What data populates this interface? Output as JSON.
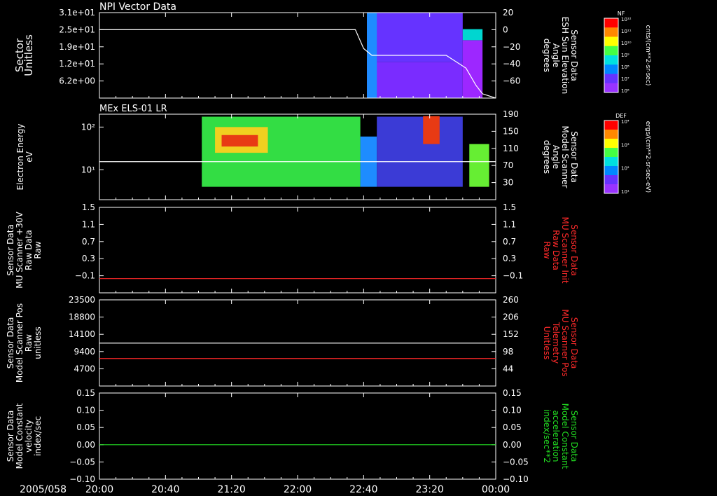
{
  "title": "NPI Vector Data",
  "colors": {
    "white": "#ffffff",
    "red": "#ff2a2a",
    "green": "#22dd22",
    "background": "#000000"
  },
  "x_axis": {
    "date_label": "2005/058",
    "tick_labels": [
      "20:00",
      "20:40",
      "21:20",
      "22:00",
      "22:40",
      "23:20",
      "00:00"
    ]
  },
  "colorbars": [
    {
      "label": "NF",
      "unit": "cnts/(cm**2-sr-sec)",
      "tick_labels": [
        "10¹²",
        "10¹¹",
        "10¹⁰",
        "10⁹",
        "10⁸",
        "10⁷",
        "10⁶"
      ]
    },
    {
      "label": "DEF",
      "unit": "ergs/(cm**2-sr-sec-eV)",
      "tick_labels": [
        "10⁴",
        "10³",
        "10²",
        "10¹"
      ]
    }
  ],
  "chart_data": [
    {
      "type": "heatmap",
      "panel_id": "npi",
      "panel_title": "",
      "ylabel": [
        "Sector",
        "Unitless"
      ],
      "yticks": [
        "3.1e+01",
        "2.5e+01",
        "1.9e+01",
        "1.2e+01",
        "6.2e+00"
      ],
      "ylim": [
        0,
        31
      ],
      "right_label": [
        "Sensor Data",
        "ESH Sun Elevation",
        "Angle",
        "degrees"
      ],
      "right_label_color": "#ffffff",
      "right_ticks": [
        "20",
        "0",
        "−20",
        "−40",
        "−60"
      ],
      "right_lim": [
        -80,
        20
      ],
      "xlim": [
        0,
        240
      ],
      "colorbar": "NF",
      "blocks": [
        {
          "x0": 162,
          "x1": 220,
          "y0": 13,
          "y1": 31,
          "color": "#6633ff"
        },
        {
          "x0": 162,
          "x1": 220,
          "y0": 0,
          "y1": 13,
          "color": "#7a2cff"
        },
        {
          "x0": 162,
          "x1": 168,
          "y0": 0,
          "y1": 31,
          "color": "#1e8cff"
        },
        {
          "x0": 220,
          "x1": 232,
          "y0": 0,
          "y1": 21,
          "color": "#9d27ff"
        },
        {
          "x0": 220,
          "x1": 232,
          "y0": 21,
          "y1": 25,
          "color": "#00d6d0"
        }
      ],
      "lines": [
        {
          "name": "Sensor Data ESH Sun Elevation Angle",
          "axis": "right",
          "color": "#ffffff",
          "x": [
            0,
            155,
            160,
            165,
            210,
            222,
            228,
            232,
            240
          ],
          "y": [
            0,
            0,
            -22,
            -30,
            -30,
            -45,
            -65,
            -75,
            -80
          ]
        }
      ]
    },
    {
      "type": "heatmap",
      "panel_id": "els",
      "panel_title": "MEx ELS-01 LR",
      "ylabel": [
        "Electron Energy",
        "eV"
      ],
      "yticks": [
        "10²",
        "10¹"
      ],
      "ylim_log": [
        2,
        200
      ],
      "right_label": [
        "Sensor Data",
        "Model Scanner",
        "Angle",
        "degrees"
      ],
      "right_label_color": "#ffffff",
      "right_ticks": [
        "190",
        "150",
        "110",
        "70",
        "30"
      ],
      "right_lim": [
        10,
        190
      ],
      "xlim": [
        0,
        240
      ],
      "colorbar": "DEF",
      "blocks": [
        {
          "x0": 62,
          "x1": 158,
          "y0": 4,
          "y1": 175,
          "color": "#33dd44"
        },
        {
          "x0": 158,
          "x1": 168,
          "y0": 4,
          "y1": 60,
          "color": "#1e8cff"
        },
        {
          "x0": 168,
          "x1": 220,
          "y0": 4,
          "y1": 175,
          "color": "#3b3bd6"
        },
        {
          "x0": 70,
          "x1": 102,
          "y0": 25,
          "y1": 100,
          "color": "#f0d020"
        },
        {
          "x0": 74,
          "x1": 96,
          "y0": 35,
          "y1": 65,
          "color": "#e83a14"
        },
        {
          "x0": 196,
          "x1": 206,
          "y0": 40,
          "y1": 180,
          "color": "#e83a14"
        },
        {
          "x0": 224,
          "x1": 236,
          "y0": 4,
          "y1": 40,
          "color": "#66ee33"
        }
      ],
      "lines": [
        {
          "name": "Sensor Data Model Scanner Angle",
          "axis": "right",
          "color": "#ffffff",
          "x": [
            0,
            240
          ],
          "y": [
            90,
            90
          ]
        }
      ]
    },
    {
      "type": "line",
      "panel_id": "mu_raw",
      "panel_title": "",
      "ylabel": [
        "Sensor Data",
        "MU Scanner +30V",
        "Raw Data",
        "Raw"
      ],
      "yticks": [
        "1.5",
        "1.1",
        "0.7",
        "0.3",
        "−0.1"
      ],
      "ylim": [
        -0.3,
        1.5
      ],
      "right_label": [
        "Sensor Data",
        "MU Scanner Init",
        "Raw Data",
        "Raw"
      ],
      "right_label_color": "#ff2a2a",
      "right_ticks": [
        "1.5",
        "1.1",
        "0.7",
        "0.3",
        "−0.1"
      ],
      "right_lim": [
        -0.3,
        1.5
      ],
      "xlim": [
        0,
        240
      ],
      "series": [
        {
          "name": "Sensor Data MU Scanner Init Raw Data",
          "axis": "right",
          "color": "#ff2a2a",
          "x": [
            0,
            240
          ],
          "y": [
            0.0,
            0.0
          ]
        }
      ]
    },
    {
      "type": "line",
      "panel_id": "scanner_pos",
      "panel_title": "",
      "ylabel": [
        "Sensor Data",
        "Model Scanner Pos",
        "Raw",
        "unitless"
      ],
      "yticks": [
        "23500",
        "18800",
        "14100",
        "9400",
        "4700"
      ],
      "ylim": [
        0,
        23500
      ],
      "right_label": [
        "Sensor Data",
        "MU Scanner Pos",
        "Telemetry",
        "Unitless"
      ],
      "right_label_color": "#ff2a2a",
      "right_ticks": [
        "260",
        "206",
        "152",
        "98",
        "44"
      ],
      "right_lim": [
        0,
        260
      ],
      "xlim": [
        0,
        240
      ],
      "series": [
        {
          "name": "Sensor Data Model Scanner Pos Raw",
          "axis": "left",
          "color": "#ffffff",
          "x": [
            0,
            240
          ],
          "y": [
            11700,
            11700
          ]
        },
        {
          "name": "Sensor Data MU Scanner Pos Telemetry",
          "axis": "right",
          "color": "#ff2a2a",
          "x": [
            0,
            240
          ],
          "y": [
            83,
            83
          ]
        }
      ]
    },
    {
      "type": "line",
      "panel_id": "constant",
      "panel_title": "",
      "ylabel": [
        "Sensor Data",
        "Model Constant",
        "velocity",
        "index/sec"
      ],
      "yticks": [
        "0.15",
        "0.10",
        "0.05",
        "0.00",
        "−0.05",
        "−0.10"
      ],
      "ylim": [
        -0.1,
        0.15
      ],
      "right_label": [
        "Sensor Data",
        "Model Constant",
        "acceleration",
        "index/sec**2"
      ],
      "right_label_color": "#22dd22",
      "right_ticks": [
        "0.15",
        "0.10",
        "0.05",
        "0.00",
        "−0.05",
        "−0.10"
      ],
      "right_lim": [
        -0.1,
        0.15
      ],
      "xlim": [
        0,
        240
      ],
      "series": [
        {
          "name": "Sensor Data Model Constant acceleration",
          "axis": "right",
          "color": "#22dd22",
          "x": [
            0,
            240
          ],
          "y": [
            0,
            0
          ]
        }
      ]
    }
  ]
}
